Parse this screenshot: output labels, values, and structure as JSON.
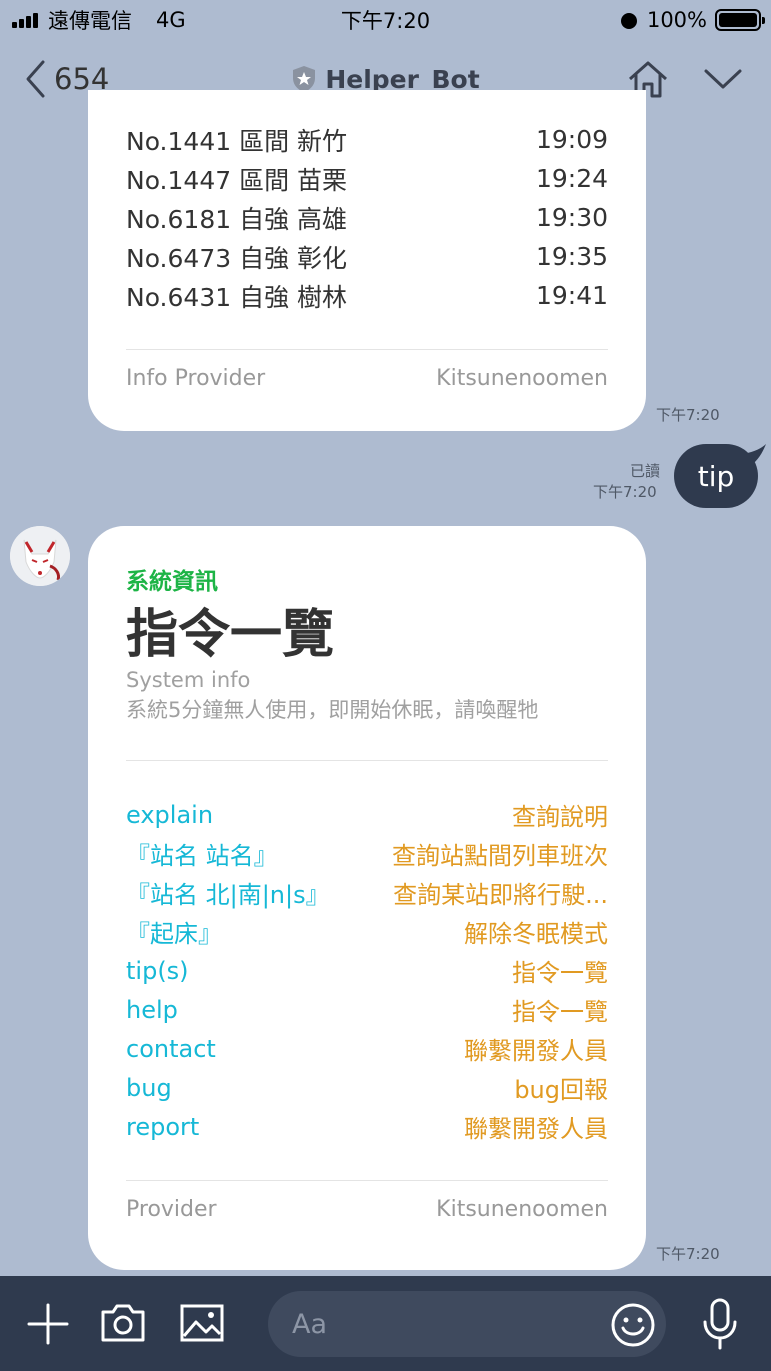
{
  "status_bar": {
    "carrier": "遠傳電信",
    "network": "4G",
    "time": "下午7:20",
    "battery": "100%"
  },
  "header": {
    "back_count": "654",
    "title": "Helper_Bot"
  },
  "card1": {
    "trains": [
      {
        "name": "No.1441 區間 新竹",
        "time": "19:09"
      },
      {
        "name": "No.1447 區間 苗栗",
        "time": "19:24"
      },
      {
        "name": "No.6181 自強 高雄",
        "time": "19:30"
      },
      {
        "name": "No.6473 自強 彰化",
        "time": "19:35"
      },
      {
        "name": "No.6431 自強 樹林",
        "time": "19:41"
      }
    ],
    "footer_left": "Info Provider",
    "footer_right": "Kitsunenoomen",
    "timestamp": "下午7:20"
  },
  "sent_message": {
    "text": "tip",
    "read_label": "已讀",
    "timestamp": "下午7:20"
  },
  "card2": {
    "label": "系統資訊",
    "title": "指令一覽",
    "subtitle": "System info",
    "note": "系統5分鐘無人使用，即開始休眠，請喚醒牠",
    "commands": [
      {
        "cmd": "explain",
        "desc": "查詢說明"
      },
      {
        "cmd": "『站名 站名』",
        "desc": "查詢站點間列車班次"
      },
      {
        "cmd": "『站名 北|南|n|s』",
        "desc": "查詢某站即將行駛..."
      },
      {
        "cmd": "『起床』",
        "desc": "解除冬眠模式"
      },
      {
        "cmd": "tip(s)",
        "desc": "指令一覽"
      },
      {
        "cmd": "help",
        "desc": "指令一覽"
      },
      {
        "cmd": "contact",
        "desc": "聯繫開發人員"
      },
      {
        "cmd": "bug",
        "desc": "bug回報"
      },
      {
        "cmd": "report",
        "desc": "聯繫開發人員"
      }
    ],
    "footer_left": "Provider",
    "footer_right": "Kitsunenoomen",
    "timestamp": "下午7:20"
  },
  "composer": {
    "placeholder": "Aa"
  },
  "colors": {
    "chat_background": "#aebbd0",
    "bar_dark": "#2f3a4e",
    "label_green": "#1db446",
    "command_cyan": "#16b8d6",
    "description_orange": "#e19a22"
  }
}
